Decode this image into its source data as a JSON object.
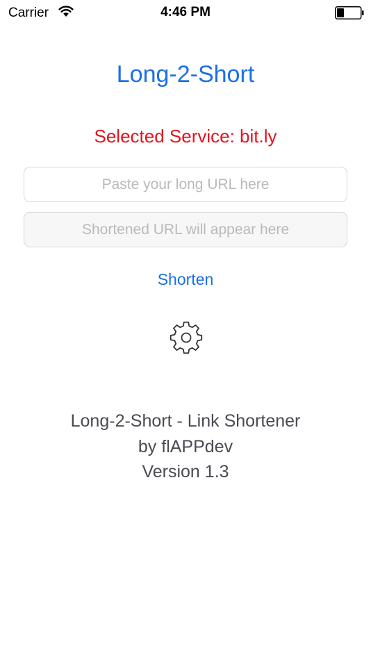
{
  "status_bar": {
    "carrier": "Carrier",
    "time": "4:46 PM",
    "icons": [
      "wifi-icon",
      "battery-icon"
    ]
  },
  "app": {
    "title": "Long-2-Short",
    "selected_service": "Selected Service: bit.ly",
    "long_url": {
      "value": "",
      "placeholder": "Paste your long URL here"
    },
    "short_url": {
      "value": "",
      "placeholder": "Shortened URL will appear here"
    },
    "shorten_label": "Shorten",
    "settings_icon": "gear-icon"
  },
  "footer": {
    "line1": "Long-2-Short - Link Shortener",
    "line2": "by flAPPdev",
    "line3": "Version 1.3"
  },
  "colors": {
    "accent": "#1a6fe8",
    "service": "#e8111c",
    "footer_text": "#4a4a52",
    "placeholder": "#b9b9be"
  }
}
